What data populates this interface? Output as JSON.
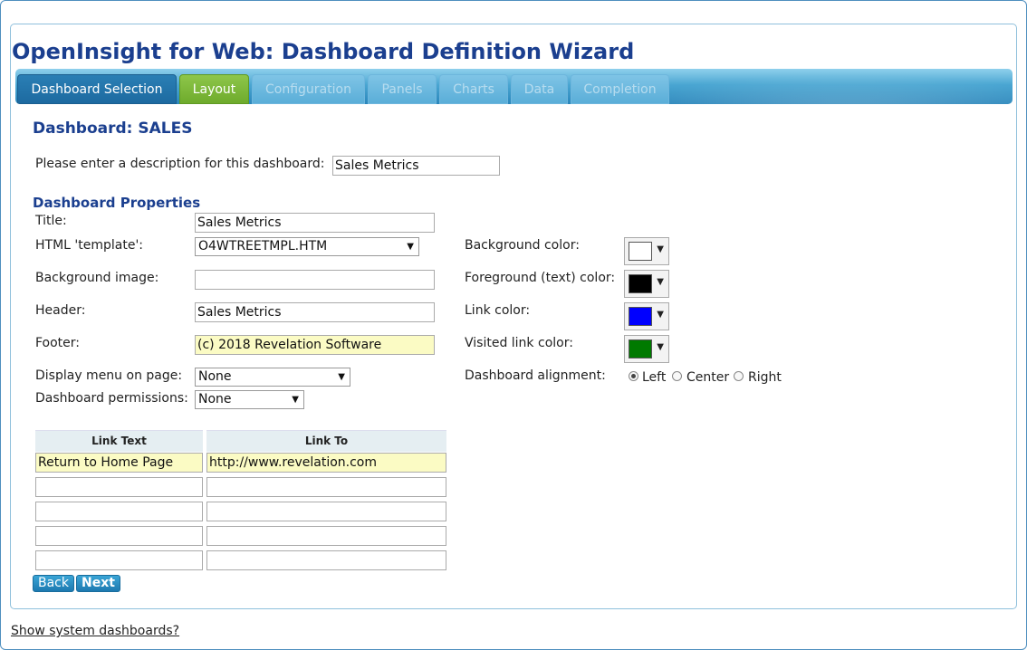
{
  "app": {
    "title": "OpenInsight for Web: Dashboard Definition Wizard"
  },
  "tabs": [
    {
      "label": "Dashboard Selection",
      "state": "visited"
    },
    {
      "label": "Layout",
      "state": "current"
    },
    {
      "label": "Configuration",
      "state": "disabled"
    },
    {
      "label": "Panels",
      "state": "disabled"
    },
    {
      "label": "Charts",
      "state": "disabled"
    },
    {
      "label": "Data",
      "state": "disabled"
    },
    {
      "label": "Completion",
      "state": "disabled"
    }
  ],
  "dashboard": {
    "heading": "Dashboard: SALES",
    "description_label": "Please enter a description for this dashboard:",
    "description_value": "Sales Metrics"
  },
  "properties": {
    "section_title": "Dashboard Properties",
    "title_label": "Title:",
    "title_value": "Sales Metrics",
    "template_label": "HTML 'template':",
    "template_value": "O4WTREETMPL.HTM",
    "bg_image_label": "Background image:",
    "bg_image_value": "",
    "header_label": "Header:",
    "header_value": "Sales Metrics",
    "footer_label": "Footer:",
    "footer_value": "(c) 2018 Revelation Software",
    "menu_label": "Display menu on page:",
    "menu_value": "None",
    "permissions_label": "Dashboard permissions:",
    "permissions_value": "None"
  },
  "colors": {
    "bg_label": "Background color:",
    "bg_value": "#ffffff",
    "fg_label": "Foreground (text) color:",
    "fg_value": "#000000",
    "link_label": "Link color:",
    "link_value": "#0000ff",
    "visited_label": "Visited link color:",
    "visited_value": "#007a00",
    "dropdown_icon": "triangle-down"
  },
  "alignment": {
    "label": "Dashboard alignment:",
    "options": [
      "Left",
      "Center",
      "Right"
    ],
    "selected": "Left"
  },
  "links": {
    "headers": [
      "Link Text",
      "Link To"
    ],
    "rows": [
      [
        "Return to Home Page",
        "http://www.revelation.com"
      ],
      [
        "",
        ""
      ],
      [
        "",
        ""
      ],
      [
        "",
        ""
      ],
      [
        "",
        ""
      ]
    ]
  },
  "buttons": {
    "back": "Back",
    "next": "Next"
  },
  "footer_link": "Show system dashboards?"
}
